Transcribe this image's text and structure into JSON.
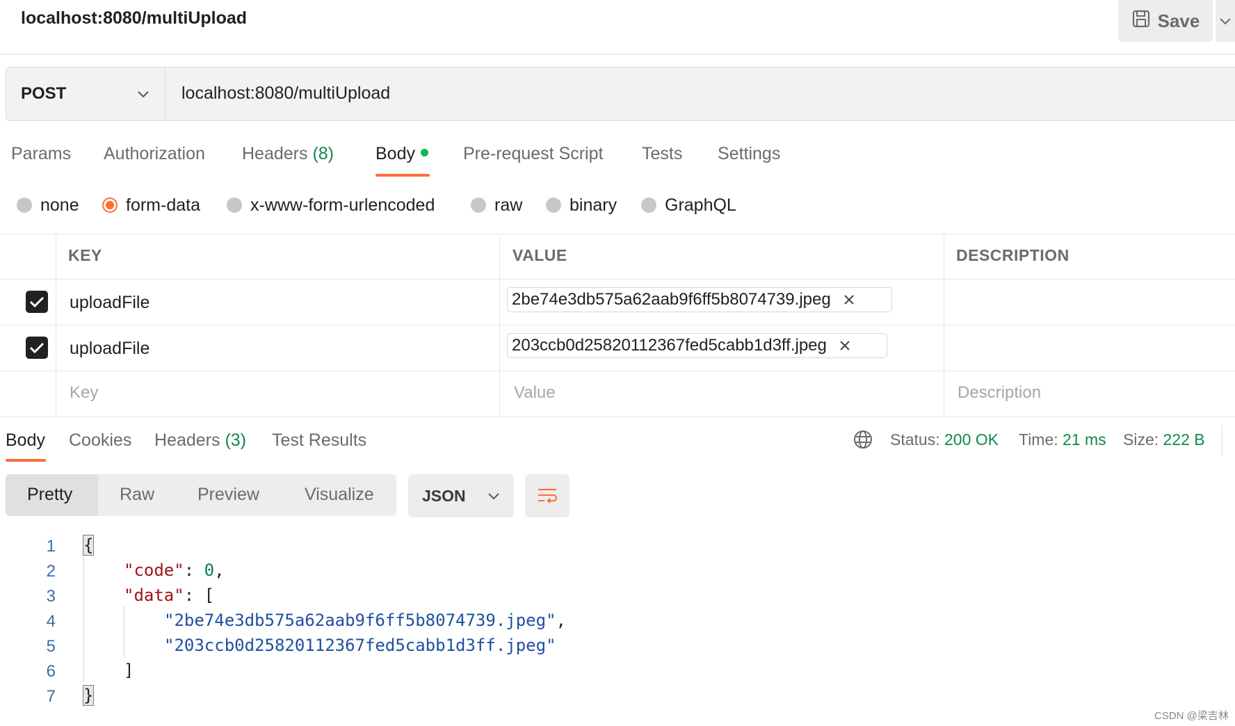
{
  "title": "localhost:8080/multiUpload",
  "save_label": "Save",
  "method": "POST",
  "url": "localhost:8080/multiUpload",
  "request_tabs": [
    {
      "label": "Params",
      "count": ""
    },
    {
      "label": "Authorization",
      "count": ""
    },
    {
      "label": "Headers",
      "count": "(8)"
    },
    {
      "label": "Body",
      "count": ""
    },
    {
      "label": "Pre-request Script",
      "count": ""
    },
    {
      "label": "Tests",
      "count": ""
    },
    {
      "label": "Settings",
      "count": ""
    }
  ],
  "body_types": [
    "none",
    "form-data",
    "x-www-form-urlencoded",
    "raw",
    "binary",
    "GraphQL"
  ],
  "body_type_selected": "form-data",
  "table": {
    "headers": [
      "KEY",
      "VALUE",
      "DESCRIPTION"
    ],
    "rows": [
      {
        "key": "uploadFile",
        "value": "2be74e3db575a62aab9f6ff5b8074739.jpeg"
      },
      {
        "key": "uploadFile",
        "value": "203ccb0d25820112367fed5cabb1d3ff.jpeg"
      }
    ],
    "placeholders": {
      "key": "Key",
      "value": "Value",
      "description": "Description"
    }
  },
  "response_tabs": [
    {
      "label": "Body",
      "count": ""
    },
    {
      "label": "Cookies",
      "count": ""
    },
    {
      "label": "Headers",
      "count": "(3)"
    },
    {
      "label": "Test Results",
      "count": ""
    }
  ],
  "status": {
    "status_label": "Status:",
    "status_value": "200 OK",
    "time_label": "Time:",
    "time_value": "21 ms",
    "size_label": "Size:",
    "size_value": "222 B"
  },
  "view_modes": [
    "Pretty",
    "Raw",
    "Preview",
    "Visualize"
  ],
  "format": "JSON",
  "code_lines": {
    "n1": "1",
    "n2": "2",
    "n3": "3",
    "n4": "4",
    "n5": "5",
    "n6": "6",
    "n7": "7",
    "open": "{",
    "code_key": "\"code\"",
    "code_val": "0",
    "data_key": "\"data\"",
    "file1": "\"2be74e3db575a62aab9f6ff5b8074739.jpeg\"",
    "file2": "\"203ccb0d25820112367fed5cabb1d3ff.jpeg\"",
    "close_bracket": "]",
    "close": "}"
  },
  "watermark": "CSDN @梁吉林",
  "colors": {
    "accent": "#ff6c37",
    "success": "#0f8a4a"
  }
}
